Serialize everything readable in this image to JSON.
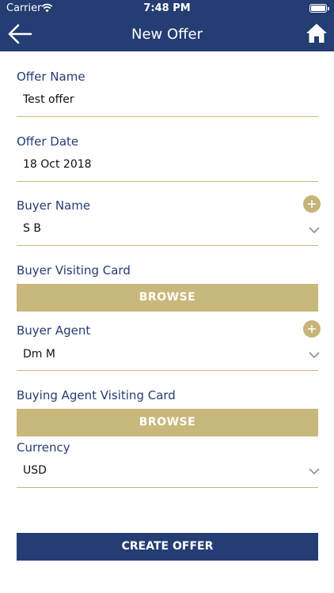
{
  "status_bar": {
    "carrier": "Carrier",
    "time": "7:48 PM"
  },
  "nav": {
    "title": "New Offer",
    "back_icon": "arrow-left-icon",
    "home_icon": "home-icon"
  },
  "form": {
    "offer_name": {
      "label": "Offer Name",
      "value": "Test offer"
    },
    "offer_date": {
      "label": "Offer Date",
      "value": "18 Oct 2018"
    },
    "buyer_name": {
      "label": "Buyer Name",
      "value": "S B"
    },
    "buyer_visiting_card": {
      "label": "Buyer Visiting Card",
      "button": "BROWSE"
    },
    "buyer_agent": {
      "label": "Buyer Agent",
      "value": "Dm M"
    },
    "buying_agent_visiting_card": {
      "label": "Buying Agent Visiting Card",
      "button": "BROWSE"
    },
    "currency": {
      "label": "Currency",
      "value": "USD"
    }
  },
  "actions": {
    "create_label": "CREATE OFFER"
  },
  "colors": {
    "primary": "#243d72",
    "accent": "#c8b87c"
  }
}
